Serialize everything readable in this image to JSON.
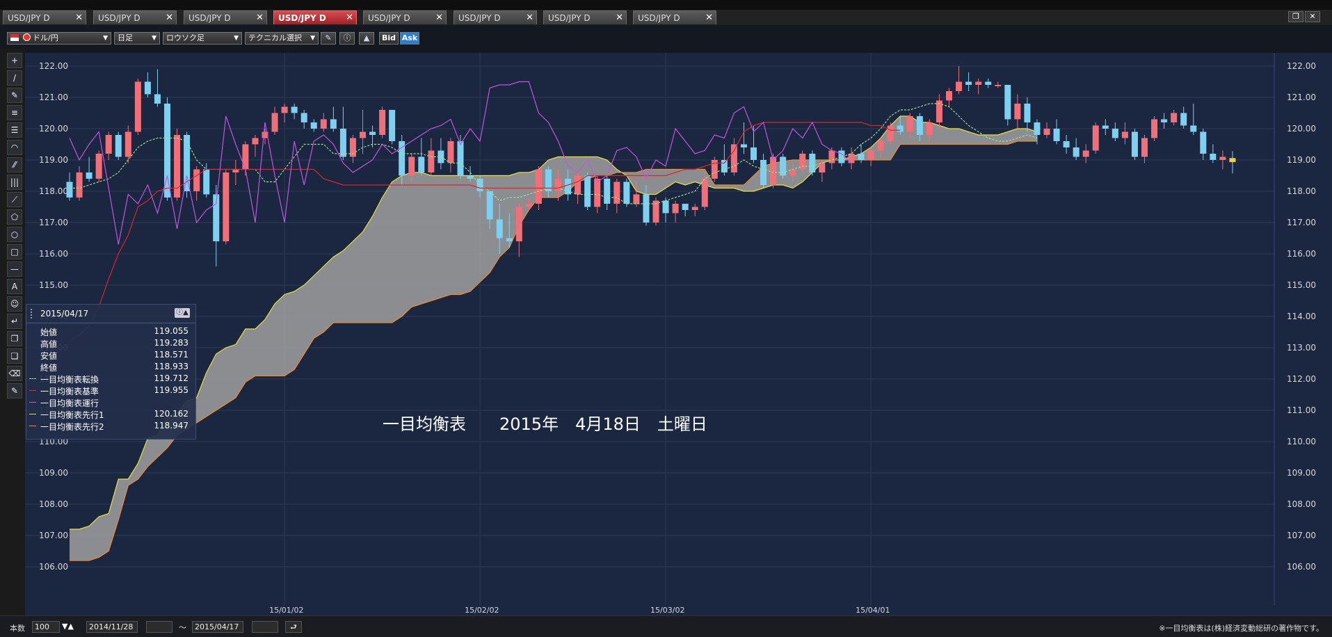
{
  "tabs": [
    {
      "label": "USD/JPY D",
      "active": false
    },
    {
      "label": "USD/JPY D",
      "active": false
    },
    {
      "label": "USD/JPY D",
      "active": false
    },
    {
      "label": "USD/JPY D",
      "active": true
    },
    {
      "label": "USD/JPY D",
      "active": false
    },
    {
      "label": "USD/JPY D",
      "active": false
    },
    {
      "label": "USD/JPY D",
      "active": false
    },
    {
      "label": "USD/JPY D",
      "active": false
    }
  ],
  "tab_close_glyph": "✕",
  "toolbar": {
    "pair": "ドル/円",
    "period": "日足",
    "chart_type": "ロウソク足",
    "technical": "テクニカル選択",
    "bid_label": "Bid",
    "ask_label": "Ask"
  },
  "left_tools": [
    "+",
    "/",
    "✎",
    "≡",
    "☰",
    "◠",
    "⁄⁄",
    "|||",
    "⟋",
    "⬠",
    "○",
    "□",
    "—",
    "A",
    "☺",
    "↵",
    "❐",
    "❑",
    "⌫",
    "✎"
  ],
  "info_panel": {
    "date": "2015/04/17",
    "rows": [
      {
        "name": "始値",
        "value": "119.055",
        "color": ""
      },
      {
        "name": "高値",
        "value": "119.283",
        "color": ""
      },
      {
        "name": "安値",
        "value": "118.571",
        "color": ""
      },
      {
        "name": "終値",
        "value": "118.933",
        "color": ""
      },
      {
        "name": "一目均衡表転換",
        "value": "119.712",
        "color": "#9be08f"
      },
      {
        "name": "一目均衡表基準",
        "value": "119.955",
        "color": "#d42a2a"
      },
      {
        "name": "一目均衡表運行",
        "value": "",
        "color": "#c455e0"
      },
      {
        "name": "一目均衡表先行1",
        "value": "120.162",
        "color": "#e6e040"
      },
      {
        "name": "一目均衡表先行2",
        "value": "118.947",
        "color": "#f08a2a"
      }
    ]
  },
  "overlay_text": "一目均衡表　　2015年　4月18日　土曜日",
  "bottom": {
    "count_label": "本数",
    "count_value": "100",
    "start_date": "2014/11/28",
    "tilde": "～",
    "end_date": "2015/04/17",
    "copyright": "※一目均衡表は(株)経済変動総研の著作物です。"
  },
  "chart_data": {
    "type": "candlestick",
    "ylim": [
      106,
      122
    ],
    "y_ticks": [
      "122.00",
      "121.00",
      "120.00",
      "119.00",
      "118.00",
      "117.00",
      "116.00",
      "115.00",
      "114.00",
      "113.00",
      "112.00",
      "111.00",
      "110.00",
      "109.00",
      "108.00",
      "107.00",
      "106.00"
    ],
    "x_ticks": [
      {
        "label": "15/01/02",
        "index": 22
      },
      {
        "label": "15/02/02",
        "index": 42
      },
      {
        "label": "15/03/02",
        "index": 61
      },
      {
        "label": "15/04/01",
        "index": 82
      }
    ],
    "n_bars": 100,
    "colors": {
      "up": "#f0707a",
      "down": "#7fd0f0",
      "tenkan": "#9be08f",
      "kijun": "#d42a2a",
      "chikou": "#c455e0",
      "spanA": "#e6e040",
      "spanB": "#f08a2a",
      "cloud": "#a0a0a0",
      "bg": "#1b2640",
      "grid": "#2c3a58"
    },
    "candles": [
      [
        118.3,
        118.6,
        117.7,
        117.8
      ],
      [
        117.8,
        118.8,
        117.7,
        118.6
      ],
      [
        118.6,
        119.1,
        118.3,
        118.4
      ],
      [
        118.4,
        119.3,
        118.3,
        119.2
      ],
      [
        119.2,
        119.9,
        119.0,
        119.8
      ],
      [
        119.8,
        119.9,
        119.0,
        119.1
      ],
      [
        119.1,
        120.1,
        118.9,
        119.9
      ],
      [
        119.9,
        121.6,
        119.8,
        121.5
      ],
      [
        121.5,
        121.8,
        121.0,
        121.1
      ],
      [
        121.1,
        121.9,
        120.7,
        120.8
      ],
      [
        120.8,
        121.0,
        117.7,
        117.8
      ],
      [
        117.8,
        120.0,
        117.7,
        119.8
      ],
      [
        119.8,
        119.9,
        117.8,
        118.0
      ],
      [
        118.0,
        118.8,
        117.7,
        118.7
      ],
      [
        118.7,
        118.9,
        117.8,
        117.9
      ],
      [
        117.9,
        118.2,
        115.6,
        116.4
      ],
      [
        116.4,
        118.7,
        116.3,
        118.6
      ],
      [
        118.6,
        119.0,
        118.2,
        118.7
      ],
      [
        118.7,
        119.6,
        118.5,
        119.5
      ],
      [
        119.5,
        119.8,
        119.1,
        119.7
      ],
      [
        119.7,
        120.0,
        119.5,
        119.9
      ],
      [
        119.9,
        120.7,
        119.8,
        120.5
      ],
      [
        120.5,
        120.8,
        120.2,
        120.7
      ],
      [
        120.7,
        120.8,
        120.3,
        120.5
      ],
      [
        120.5,
        120.6,
        120.0,
        120.2
      ],
      [
        120.2,
        120.3,
        119.9,
        120.0
      ],
      [
        120.0,
        120.5,
        119.9,
        120.3
      ],
      [
        120.3,
        120.7,
        119.9,
        120.0
      ],
      [
        120.0,
        120.7,
        119.0,
        119.1
      ],
      [
        119.1,
        119.8,
        118.9,
        119.7
      ],
      [
        119.7,
        120.6,
        119.2,
        119.9
      ],
      [
        119.9,
        120.1,
        119.4,
        119.8
      ],
      [
        119.8,
        120.7,
        119.7,
        120.6
      ],
      [
        120.6,
        120.6,
        119.5,
        119.6
      ],
      [
        119.6,
        119.8,
        118.2,
        118.5
      ],
      [
        118.5,
        119.2,
        118.3,
        119.1
      ],
      [
        119.1,
        119.7,
        118.5,
        118.6
      ],
      [
        118.6,
        119.7,
        118.5,
        119.3
      ],
      [
        119.3,
        119.7,
        118.7,
        118.9
      ],
      [
        118.9,
        119.7,
        118.6,
        119.6
      ],
      [
        119.6,
        119.8,
        118.4,
        118.5
      ],
      [
        118.5,
        118.8,
        118.3,
        118.4
      ],
      [
        118.4,
        118.5,
        117.8,
        118.0
      ],
      [
        118.0,
        118.0,
        116.8,
        117.1
      ],
      [
        117.1,
        117.6,
        116.0,
        116.5
      ],
      [
        116.5,
        117.3,
        116.2,
        116.4
      ],
      [
        116.4,
        117.6,
        115.9,
        117.5
      ],
      [
        117.5,
        117.8,
        117.4,
        117.6
      ],
      [
        117.6,
        118.8,
        117.4,
        118.7
      ],
      [
        118.7,
        118.8,
        117.8,
        118.0
      ],
      [
        118.0,
        118.7,
        117.7,
        118.4
      ],
      [
        118.4,
        118.7,
        117.7,
        117.9
      ],
      [
        117.9,
        118.6,
        117.6,
        118.5
      ],
      [
        118.5,
        118.6,
        117.4,
        117.5
      ],
      [
        117.5,
        118.5,
        117.3,
        118.4
      ],
      [
        118.4,
        118.5,
        117.4,
        117.6
      ],
      [
        117.6,
        118.4,
        117.3,
        118.3
      ],
      [
        118.3,
        118.4,
        117.5,
        117.6
      ],
      [
        117.6,
        118.3,
        117.5,
        117.9
      ],
      [
        117.9,
        118.2,
        116.9,
        117.0
      ],
      [
        117.0,
        117.8,
        116.9,
        117.7
      ],
      [
        117.7,
        117.8,
        117.0,
        117.3
      ],
      [
        117.3,
        117.7,
        117.0,
        117.6
      ],
      [
        117.6,
        117.6,
        117.2,
        117.4
      ],
      [
        117.4,
        117.6,
        117.2,
        117.5
      ],
      [
        117.5,
        118.6,
        117.4,
        118.4
      ],
      [
        118.4,
        119.1,
        118.3,
        119.0
      ],
      [
        119.0,
        119.5,
        118.5,
        118.6
      ],
      [
        118.6,
        119.7,
        118.5,
        119.5
      ],
      [
        119.5,
        120.2,
        119.2,
        119.4
      ]
    ],
    "candles2": [
      [
        119.4,
        120.1,
        118.9,
        119.0
      ],
      [
        119.0,
        119.2,
        118.1,
        118.2
      ],
      [
        118.2,
        119.2,
        118.1,
        119.1
      ],
      [
        119.1,
        119.2,
        118.4,
        118.5
      ],
      [
        118.5,
        118.9,
        118.3,
        118.7
      ],
      [
        118.7,
        119.3,
        118.6,
        119.2
      ],
      [
        119.2,
        119.3,
        118.5,
        118.6
      ],
      [
        118.6,
        119.0,
        118.3,
        118.9
      ],
      [
        118.9,
        119.4,
        118.7,
        119.3
      ],
      [
        119.3,
        119.4,
        118.8,
        118.9
      ],
      [
        118.9,
        119.4,
        118.7,
        119.2
      ],
      [
        119.2,
        119.5,
        118.9,
        119.0
      ],
      [
        119.0,
        119.4,
        118.8,
        119.3
      ],
      [
        119.3,
        119.7,
        119.1,
        119.6
      ],
      [
        119.6,
        120.2,
        119.5,
        120.1
      ],
      [
        120.1,
        120.4,
        119.8,
        119.9
      ],
      [
        119.9,
        120.5,
        119.7,
        120.4
      ],
      [
        120.4,
        120.5,
        119.6,
        119.8
      ],
      [
        119.8,
        120.3,
        119.6,
        120.2
      ],
      [
        120.2,
        121.1,
        120.0,
        120.9
      ],
      [
        120.9,
        121.3,
        120.7,
        121.2
      ],
      [
        121.2,
        122.0,
        121.1,
        121.5
      ],
      [
        121.5,
        121.8,
        121.2,
        121.4
      ],
      [
        121.4,
        121.6,
        121.1,
        121.5
      ],
      [
        121.5,
        121.6,
        121.3,
        121.4
      ],
      [
        121.4,
        121.5,
        121.3,
        121.4
      ],
      [
        121.4,
        121.4,
        120.1,
        120.3
      ],
      [
        120.3,
        121.1,
        120.0,
        120.8
      ],
      [
        120.8,
        121.0,
        119.9,
        120.2
      ],
      [
        120.2,
        120.3,
        119.5,
        119.8
      ],
      [
        119.8,
        120.2,
        119.7,
        120.0
      ],
      [
        120.0,
        120.3,
        119.5,
        119.6
      ],
      [
        119.6,
        119.8,
        119.2,
        119.4
      ],
      [
        119.4,
        119.7,
        119.0,
        119.1
      ],
      [
        119.1,
        119.5,
        118.9,
        119.3
      ],
      [
        119.3,
        120.2,
        119.2,
        120.1
      ],
      [
        120.1,
        120.3,
        119.8,
        120.0
      ],
      [
        120.0,
        120.2,
        119.6,
        119.7
      ],
      [
        119.7,
        120.2,
        119.5,
        119.9
      ],
      [
        119.9,
        120.0,
        119.0,
        119.1
      ],
      [
        119.1,
        119.8,
        118.9,
        119.7
      ],
      [
        119.7,
        120.4,
        119.6,
        120.3
      ],
      [
        120.3,
        120.5,
        120.0,
        120.2
      ],
      [
        120.2,
        120.6,
        120.1,
        120.5
      ],
      [
        120.5,
        120.7,
        120.0,
        120.1
      ],
      [
        120.1,
        120.8,
        119.8,
        119.9
      ],
      [
        119.9,
        120.0,
        119.0,
        119.2
      ],
      [
        119.2,
        119.5,
        118.9,
        119.0
      ],
      [
        119.0,
        119.3,
        118.7,
        119.1
      ],
      [
        119.06,
        119.28,
        118.57,
        118.93
      ]
    ],
    "tenkan": [
      118.1,
      118.1,
      118.2,
      118.3,
      118.4,
      118.6,
      119.0,
      119.4,
      119.6,
      119.7,
      119.7,
      119.7,
      119.6,
      119.0,
      118.7,
      118.7,
      118.7,
      118.7,
      118.7,
      118.7,
      118.3,
      118.3,
      118.7,
      119.1,
      119.5,
      119.5,
      119.5,
      119.2,
      119.2,
      119.2,
      119.4,
      119.5,
      119.5,
      119.4,
      119.2,
      119.2,
      119.2,
      119.1,
      119.1,
      118.9,
      118.9,
      118.6,
      118.2,
      118.0,
      117.7,
      117.8,
      117.8,
      117.9,
      118.0,
      118.1,
      118.1,
      118.0,
      117.9,
      117.9,
      117.9,
      117.8,
      117.8,
      117.6,
      117.6,
      117.6,
      117.6,
      117.7,
      117.8,
      117.9,
      118.0,
      118.4,
      118.6,
      118.7,
      118.8,
      119.0,
      118.8,
      118.7,
      118.6,
      118.6,
      118.7,
      118.8,
      118.8,
      118.9,
      119.0,
      119.1,
      119.2,
      119.5,
      119.7,
      120.0,
      120.4,
      120.6,
      120.6,
      120.7,
      120.8,
      120.8,
      120.7,
      120.4,
      120.1,
      119.9,
      119.7,
      119.6,
      119.6,
      119.7,
      119.8,
      119.7
    ],
    "kijun": [
      113.2,
      113.4,
      113.7,
      114.3,
      115.2,
      116.0,
      116.6,
      117.5,
      117.7,
      118.0,
      118.1,
      118.1,
      118.3,
      118.5,
      118.7,
      118.7,
      118.7,
      118.7,
      118.7,
      118.7,
      118.7,
      118.7,
      118.7,
      118.7,
      118.7,
      118.7,
      118.4,
      118.3,
      118.2,
      118.2,
      118.2,
      118.2,
      118.2,
      118.2,
      118.2,
      118.2,
      118.2,
      118.2,
      118.2,
      118.2,
      118.2,
      118.2,
      118.1,
      118.1,
      118.1,
      118.1,
      118.1,
      118.1,
      118.1,
      118.1,
      118.1,
      118.2,
      118.3,
      118.5,
      118.5,
      118.5,
      118.5,
      118.5,
      118.5,
      118.5,
      118.5,
      118.5,
      118.6,
      118.7,
      118.7,
      118.8,
      118.9,
      118.9,
      119.3,
      119.9,
      120.1,
      120.2,
      120.2,
      120.2,
      120.2,
      120.2,
      120.2,
      120.2,
      120.2,
      120.2,
      120.2,
      120.2,
      120.1,
      120.1,
      119.95,
      119.95
    ],
    "chikou": [
      119.7,
      119.0,
      119.5,
      119.9,
      118.1,
      116.3,
      117.9,
      117.6,
      118.2,
      117.3,
      118.5,
      116.8,
      118.5,
      117.0,
      117.4,
      117.6,
      120.4,
      119.5,
      118.7,
      117.0,
      120.2,
      118.5,
      117.0,
      119.6,
      118.2,
      119.6,
      119.8,
      119.5,
      118.9,
      118.6,
      118.8,
      119.0,
      119.5,
      119.2,
      119.4,
      119.6,
      119.8,
      120.0,
      120.1,
      120.3,
      119.5,
      120.0,
      119.6,
      121.3,
      121.4,
      121.4,
      121.5,
      121.5,
      120.5,
      120.2,
      119.6,
      118.8,
      118.6,
      119.0,
      118.3,
      118.5,
      119.3,
      119.4,
      119.1,
      118.4,
      119.0,
      118.8,
      120.0,
      119.6,
      119.2,
      119.3,
      119.8,
      119.7,
      120.5,
      120.7,
      119.9,
      120.2,
      119.0,
      119.3,
      120.0,
      119.7,
      120.2,
      119.5,
      119.3,
      119.2,
      118.9
    ],
    "spanA": [
      107.2,
      107.2,
      107.3,
      107.6,
      107.7,
      108.8,
      108.8,
      109.3,
      110.1,
      110.2,
      110.8,
      110.9,
      111.3,
      111.4,
      112.2,
      112.8,
      113.0,
      113.1,
      113.6,
      113.6,
      113.9,
      114.4,
      114.7,
      114.8,
      115.0,
      115.3,
      115.6,
      115.9,
      116.1,
      116.4,
      116.7,
      117.2,
      117.8,
      118.3,
      118.5,
      118.6,
      118.6,
      118.5,
      118.5,
      118.5,
      118.5,
      118.5,
      118.5,
      118.5,
      118.5,
      118.5,
      118.6,
      118.6,
      118.7,
      119.0,
      119.1,
      119.1,
      119.1,
      119.1,
      119.1,
      119.0,
      118.7,
      118.5,
      118.0,
      117.9,
      117.9,
      118.1,
      118.3,
      118.2,
      118.3,
      118.2,
      118.1,
      118.1,
      118.1,
      118.0,
      118.0,
      118.1,
      118.2,
      118.2,
      118.1,
      118.3,
      118.6,
      118.9,
      119.0,
      119.0,
      119.1,
      119.2,
      119.4,
      119.7,
      120.1,
      120.4,
      120.4,
      120.2,
      120.2,
      120.1,
      120.0,
      120.0,
      119.9,
      119.8,
      119.8,
      119.8,
      119.9,
      120.0,
      120.0,
      119.9
    ],
    "spanB": [
      106.2,
      106.2,
      106.2,
      106.3,
      106.5,
      107.5,
      108.6,
      108.8,
      109.2,
      109.5,
      109.8,
      110.2,
      110.4,
      110.6,
      110.8,
      111.0,
      111.2,
      111.4,
      111.9,
      112.1,
      112.1,
      112.1,
      112.1,
      112.3,
      112.8,
      113.3,
      113.5,
      113.8,
      113.8,
      113.8,
      113.8,
      113.8,
      113.8,
      113.8,
      114.0,
      114.3,
      114.4,
      114.5,
      114.6,
      114.7,
      114.7,
      114.8,
      115.1,
      115.4,
      115.9,
      116.2,
      116.9,
      117.4,
      117.8,
      117.8,
      117.8,
      118.0,
      118.3,
      118.4,
      118.5,
      118.5,
      118.6,
      118.6,
      118.6,
      118.7,
      118.7,
      118.7,
      118.7,
      118.7,
      118.7,
      118.7,
      118.2,
      118.2,
      118.2,
      118.2,
      118.5,
      118.8,
      118.9,
      118.95,
      119.0,
      119.0,
      119.0,
      119.0,
      119.0,
      119.0,
      119.0,
      119.0,
      119.0,
      119.0,
      119.0,
      119.5,
      119.5,
      119.5,
      119.5,
      119.5,
      119.5,
      119.5,
      119.5,
      119.5,
      119.5,
      119.5,
      119.5,
      119.6,
      119.6,
      119.6
    ]
  }
}
